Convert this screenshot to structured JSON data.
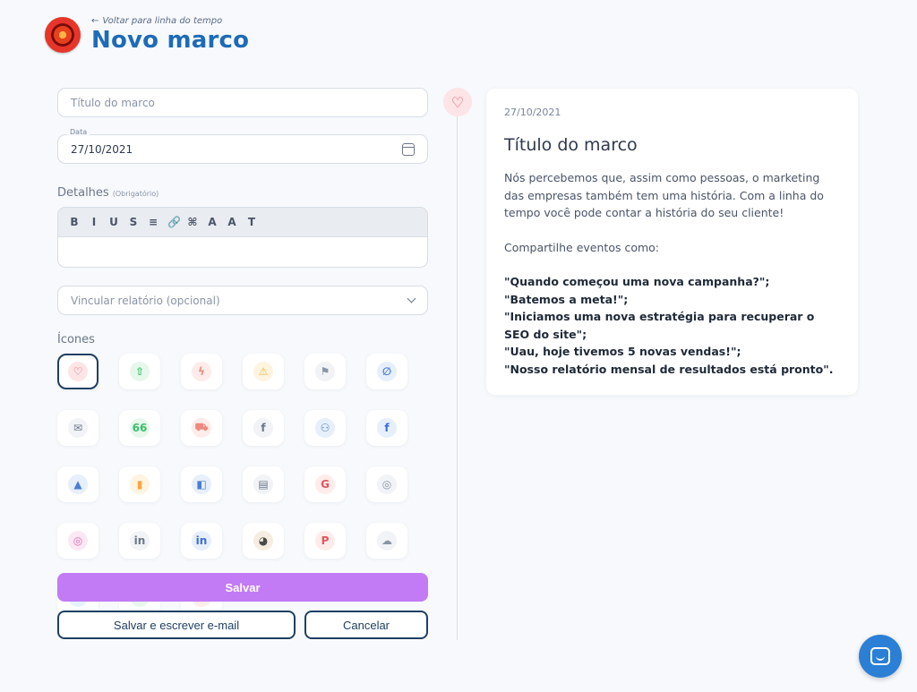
{
  "header": {
    "back_label": "Voltar para linha do tempo",
    "title": "Novo marco"
  },
  "form": {
    "title_placeholder": "Título do marco",
    "date_label": "Data",
    "date_value": "27/10/2021",
    "details_label": "Detalhes",
    "details_required": "(Obrigatório)",
    "toolbar": [
      {
        "name": "bold",
        "glyph": "B"
      },
      {
        "name": "italic",
        "glyph": "I"
      },
      {
        "name": "underline",
        "glyph": "U"
      },
      {
        "name": "strikethrough",
        "glyph": "S"
      },
      {
        "name": "align",
        "glyph": "≡"
      },
      {
        "name": "link",
        "glyph": "🔗"
      },
      {
        "name": "attach",
        "glyph": "⌘"
      },
      {
        "name": "text-color",
        "glyph": "A"
      },
      {
        "name": "highlight",
        "glyph": "A"
      },
      {
        "name": "clear-format",
        "glyph": "T"
      }
    ],
    "report_placeholder": "Vincular relatório (opcional)",
    "icons_label": "Ícones",
    "icons": [
      {
        "name": "heart-icon",
        "glyph": "♡",
        "color": "#e0565f",
        "bg": "#fde4e6"
      },
      {
        "name": "rocket-icon",
        "glyph": "⇧",
        "color": "#3bbf6b",
        "bg": "#e6f7ec"
      },
      {
        "name": "lightning-icon",
        "glyph": "ϟ",
        "color": "#f08a7e",
        "bg": "#fdecea"
      },
      {
        "name": "warning-icon",
        "glyph": "⚠",
        "color": "#f5b942",
        "bg": "#fef4e0"
      },
      {
        "name": "flag-icon",
        "glyph": "⚑",
        "color": "#8a94a6",
        "bg": "#f1f3f6"
      },
      {
        "name": "paperclip-icon",
        "glyph": "∅",
        "color": "#4a7fd4",
        "bg": "#e7effb"
      },
      {
        "name": "email-icon",
        "glyph": "✉",
        "color": "#6b778a",
        "bg": "#f1f3f6"
      },
      {
        "name": "quote-icon",
        "glyph": "66",
        "color": "#3bbf6b",
        "bg": "#e6f7ec"
      },
      {
        "name": "cart-icon",
        "glyph": "⛟",
        "color": "#f08a7e",
        "bg": "#fdecea"
      },
      {
        "name": "facebook-square-icon",
        "glyph": "f",
        "color": "#6b778a",
        "bg": "#f1f3f6"
      },
      {
        "name": "users-icon",
        "glyph": "⚇",
        "color": "#4a7fd4",
        "bg": "#e7effb"
      },
      {
        "name": "facebook-icon",
        "glyph": "f",
        "color": "#3b6fd4",
        "bg": "#e7effb"
      },
      {
        "name": "google-ads-icon",
        "glyph": "▲",
        "color": "#4a7fd4",
        "bg": "#e7effb"
      },
      {
        "name": "analytics-icon",
        "glyph": "▮",
        "color": "#f5a742",
        "bg": "#fef4e0"
      },
      {
        "name": "data-studio-icon",
        "glyph": "◧",
        "color": "#4a7fd4",
        "bg": "#e7effb"
      },
      {
        "name": "tag-manager-icon",
        "glyph": "▤",
        "color": "#6b778a",
        "bg": "#f1f3f6"
      },
      {
        "name": "google-icon",
        "glyph": "G",
        "color": "#e0565f",
        "bg": "#fdecea"
      },
      {
        "name": "instagram-outline-icon",
        "glyph": "◎",
        "color": "#8a94a6",
        "bg": "#f1f3f6"
      },
      {
        "name": "instagram-icon",
        "glyph": "◎",
        "color": "#e06bb0",
        "bg": "#fce8f3"
      },
      {
        "name": "linkedin-square-icon",
        "glyph": "in",
        "color": "#6b778a",
        "bg": "#f1f3f6"
      },
      {
        "name": "linkedin-icon",
        "glyph": "in",
        "color": "#3b6fd4",
        "bg": "#e7effb"
      },
      {
        "name": "mailchimp-icon",
        "glyph": "◕",
        "color": "#4a4a4a",
        "bg": "#f5eee0"
      },
      {
        "name": "pinterest-icon",
        "glyph": "P",
        "color": "#e0565f",
        "bg": "#fdecea"
      },
      {
        "name": "snapchat-icon",
        "glyph": "☁",
        "color": "#8a94a6",
        "bg": "#f1f3f6"
      },
      {
        "name": "twitter-icon",
        "glyph": "✦",
        "color": "#3ba1e0",
        "bg": "#e4f3fc"
      },
      {
        "name": "whatsapp-icon",
        "glyph": "☏",
        "color": "#3bbf6b",
        "bg": "#e6f7ec"
      },
      {
        "name": "youtube-icon",
        "glyph": "▶",
        "color": "#e0565f",
        "bg": "#fdecea"
      }
    ],
    "save_label": "Salvar",
    "save_email_label": "Salvar e escrever e-mail",
    "cancel_label": "Cancelar"
  },
  "preview": {
    "date": "27/10/2021",
    "title": "Título do marco",
    "intro": "Nós percebemos que, assim como pessoas, o marketing das empresas também tem uma história. Com a linha do tempo você pode contar a história do seu cliente!",
    "share_label": "Compartilhe eventos como:",
    "examples": [
      "\"Quando começou uma nova campanha?\";",
      "\"Batemos a meta!\";",
      "\"Iniciamos uma nova estratégia para recuperar o SEO do site\";",
      "\"Uau, hoje tivemos 5 novas vendas!\";",
      "\"Nosso relatório mensal de resultados está pronto\"."
    ]
  },
  "colors": {
    "accent": "#1e6bb8",
    "save_button": "#c27bf5",
    "outline": "#1f3f63"
  }
}
